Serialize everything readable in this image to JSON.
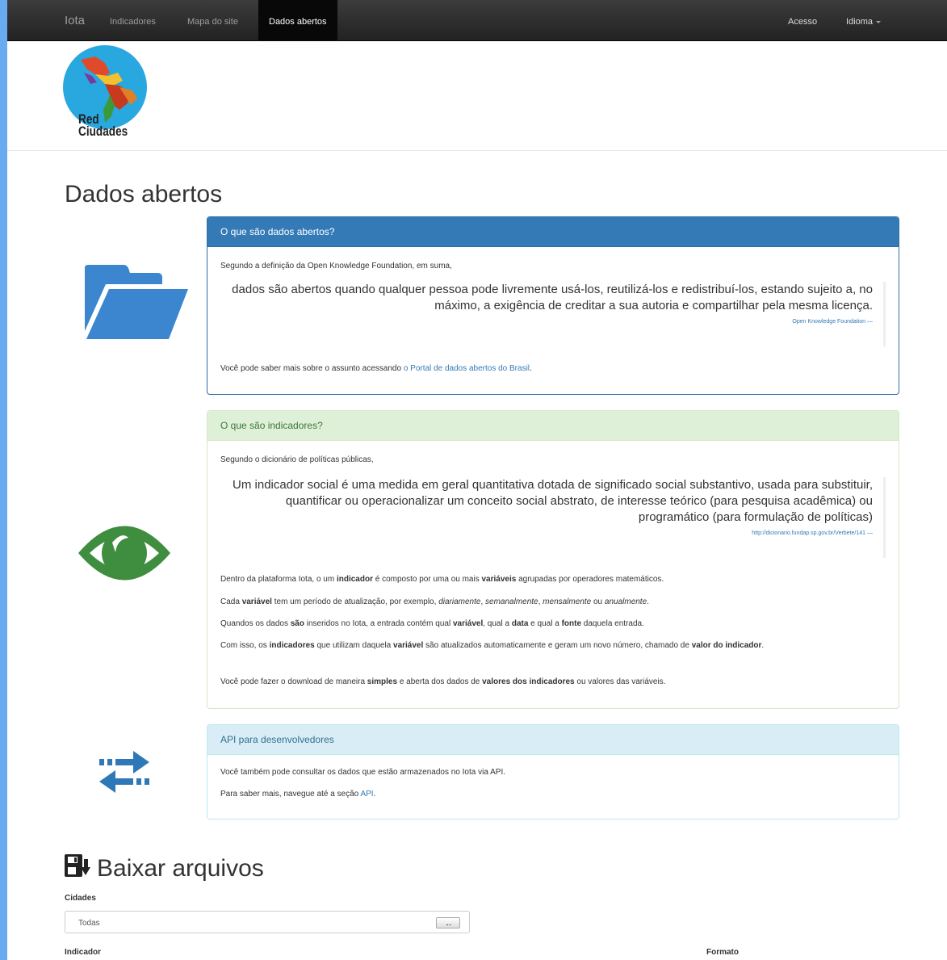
{
  "navbar": {
    "brand": "Iota",
    "links": [
      "Indicadores",
      "Mapa do site",
      "Dados abertos"
    ],
    "right": {
      "login": "Acesso",
      "language": "Idioma"
    }
  },
  "logo": {
    "line1": "Red",
    "line2": "Ciudades"
  },
  "page": {
    "title": "Dados abertos"
  },
  "panels": {
    "open_data": {
      "heading": "O que são dados abertos?",
      "intro": "Segundo a definição da Open Knowledge Foundation, em suma,",
      "quote": "dados são abertos quando qualquer pessoa pode livremente usá-los, reutilizá-los e redistribuí-los, estando sujeito a, no máximo, a exigência de creditar a sua autoria e compartilhar pela mesma licença.",
      "quote_source": "Open Knowledge Foundation —",
      "more_prefix": "Você pode saber mais sobre o assunto acessando ",
      "more_link": "o Portal de dados abertos do Brasil",
      "more_suffix": "."
    },
    "indicators": {
      "heading": "O que são indicadores?",
      "intro": "Segundo o dicionário de políticas públicas,",
      "quote": "Um indicador social é uma medida em geral quantitativa dotada de significado social substantivo, usada para substituir, quantificar ou operacionalizar um conceito social abstrato, de interesse teórico (para pesquisa acadêmica) ou programático (para formulação de políticas)",
      "quote_source": "http://dicionario.fundap.sp.gov.br/Verbete/141 —",
      "p1": [
        {
          "t": "Dentro da plataforma Iota, o um ",
          "b": false
        },
        {
          "t": "indicador",
          "b": true
        },
        {
          "t": " é composto por uma ou mais ",
          "b": false
        },
        {
          "t": "variáveis",
          "b": true
        },
        {
          "t": " agrupadas por operadores matemáticos.",
          "b": false
        }
      ],
      "p2": [
        {
          "t": "Cada ",
          "b": false
        },
        {
          "t": "variável",
          "b": true
        },
        {
          "t": " tem um período de atualização, por exemplo, ",
          "b": false
        },
        {
          "t": "diariamente",
          "i": true
        },
        {
          "t": ", ",
          "b": false
        },
        {
          "t": "semanalmente",
          "i": true
        },
        {
          "t": ", ",
          "b": false
        },
        {
          "t": "mensalmente",
          "i": true
        },
        {
          "t": " ou ",
          "b": false
        },
        {
          "t": "anualmente",
          "i": true
        },
        {
          "t": ".",
          "b": false
        }
      ],
      "p3": [
        {
          "t": "Quandos os dados ",
          "b": false
        },
        {
          "t": "são",
          "b": true
        },
        {
          "t": " inseridos no Iota, a entrada contém qual ",
          "b": false
        },
        {
          "t": "variável",
          "b": true
        },
        {
          "t": ", qual a ",
          "b": false
        },
        {
          "t": "data",
          "b": true
        },
        {
          "t": " e qual a ",
          "b": false
        },
        {
          "t": "fonte",
          "b": true
        },
        {
          "t": " daquela entrada.",
          "b": false
        }
      ],
      "p4": [
        {
          "t": "Com isso, os ",
          "b": false
        },
        {
          "t": "indicadores",
          "b": true
        },
        {
          "t": " que utilizam daquela ",
          "b": false
        },
        {
          "t": "variável",
          "b": true
        },
        {
          "t": " são atualizados automaticamente e geram um novo número, chamado de ",
          "b": false
        },
        {
          "t": "valor do indicador",
          "b": true
        },
        {
          "t": ".",
          "b": false
        }
      ],
      "p5": [
        {
          "t": "Você pode fazer o download de maneira ",
          "b": false
        },
        {
          "t": "simples",
          "b": true
        },
        {
          "t": " e aberta dos dados de ",
          "b": false
        },
        {
          "t": "valores dos indicadores",
          "b": true
        },
        {
          "t": " ou valores das variáveis.",
          "b": false
        }
      ]
    },
    "api": {
      "heading": "API para desenvolvedores",
      "p1": "Você também pode consultar os dados que estão armazenados no Iota via API.",
      "p2_prefix": "Para saber mais, navegue até a seção ",
      "p2_link": "API",
      "p2_suffix": "."
    }
  },
  "download": {
    "title": "Baixar arquivos",
    "cities_label": "Cidades",
    "cities_value": "Todas",
    "indicator_label": "Indicador",
    "format_label": "Formato"
  },
  "colors": {
    "primary": "#337ab7",
    "success_bg": "#dff0d8",
    "info_bg": "#d9edf7",
    "folder": "#3b86cf",
    "eye": "#3f8d3f",
    "arrows": "#2f78b8"
  }
}
